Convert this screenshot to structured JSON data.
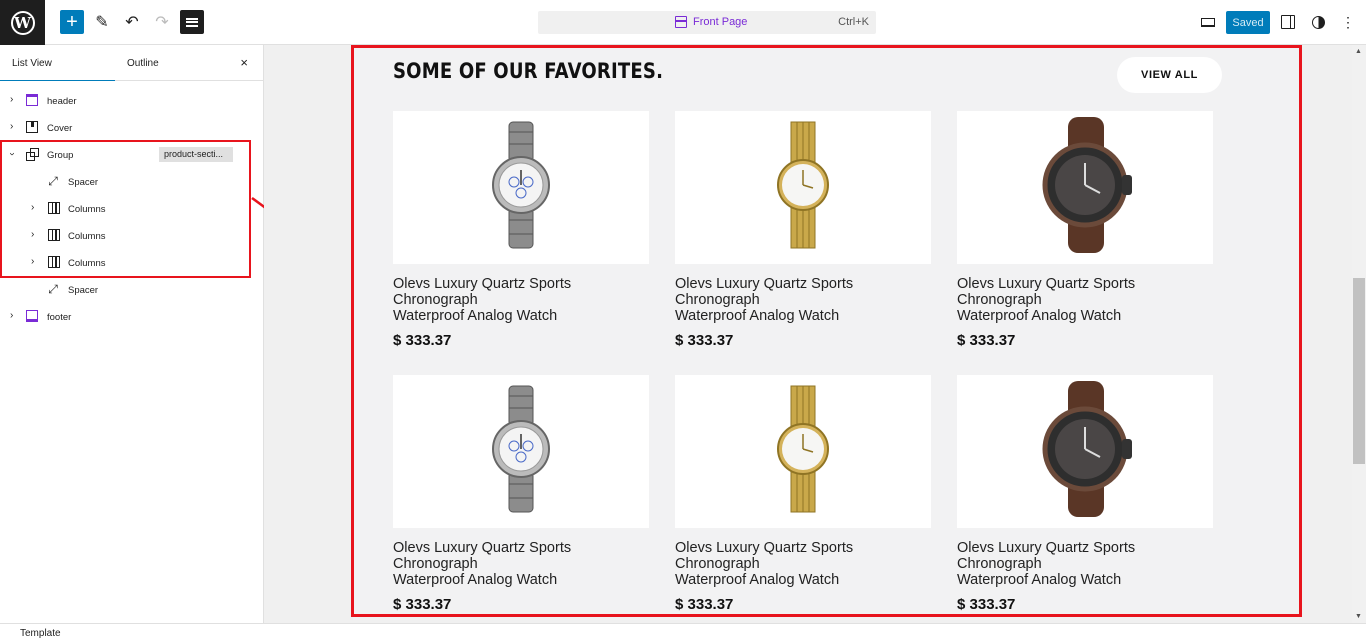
{
  "toolbar": {
    "add_label": "+",
    "document_title": "Front Page",
    "command_shortcut": "Ctrl+K",
    "save_status": "Saved",
    "more_label": "⋮"
  },
  "sidebar": {
    "tabs": [
      {
        "label": "List View",
        "active": true
      },
      {
        "label": "Outline",
        "active": false
      }
    ],
    "close_label": "×",
    "tree": [
      {
        "label": "header",
        "icon": "template-part-icon",
        "expanded": false
      },
      {
        "label": "Cover",
        "icon": "cover-icon",
        "expanded": false
      },
      {
        "label": "Group",
        "icon": "group-icon",
        "expanded": true,
        "badge": "product-secti..."
      },
      {
        "label": "Spacer",
        "icon": "spacer-icon"
      },
      {
        "label": "Columns",
        "icon": "columns-icon",
        "expanded": false
      },
      {
        "label": "Columns",
        "icon": "columns-icon",
        "expanded": false
      },
      {
        "label": "Columns",
        "icon": "columns-icon",
        "expanded": false
      },
      {
        "label": "Spacer",
        "icon": "spacer-icon"
      },
      {
        "label": "footer",
        "icon": "template-part-icon",
        "expanded": false
      }
    ]
  },
  "canvas": {
    "section_title": "SOME OF OUR FAVORITES.",
    "view_all_label": "VIEW ALL",
    "products": [
      {
        "name_line1": "Olevs Luxury Quartz Sports",
        "name_line2": "Chronograph",
        "name_line3": "Waterproof Analog Watch",
        "price": "$ 333.37",
        "watch": "silver"
      },
      {
        "name_line1": "Olevs Luxury Quartz Sports",
        "name_line2": "Chronograph",
        "name_line3": "Waterproof Analog Watch",
        "price": "$ 333.37",
        "watch": "gold"
      },
      {
        "name_line1": "Olevs Luxury Quartz Sports",
        "name_line2": "Chronograph",
        "name_line3": "Waterproof Analog Watch",
        "price": "$ 333.37",
        "watch": "brown"
      },
      {
        "name_line1": "Olevs Luxury Quartz Sports",
        "name_line2": "Chronograph",
        "name_line3": "Waterproof Analog Watch",
        "price": "$ 333.37",
        "watch": "silver"
      },
      {
        "name_line1": "Olevs Luxury Quartz Sports",
        "name_line2": "Chronograph",
        "name_line3": "Waterproof Analog Watch",
        "price": "$ 333.37",
        "watch": "gold"
      },
      {
        "name_line1": "Olevs Luxury Quartz Sports",
        "name_line2": "Chronograph",
        "name_line3": "Waterproof Analog Watch",
        "price": "$ 333.37",
        "watch": "brown"
      }
    ]
  },
  "status_bar": {
    "label": "Template"
  },
  "colors": {
    "accent": "#007cba",
    "template_purple": "#7a2bd6",
    "highlight_red": "#e8141d"
  }
}
